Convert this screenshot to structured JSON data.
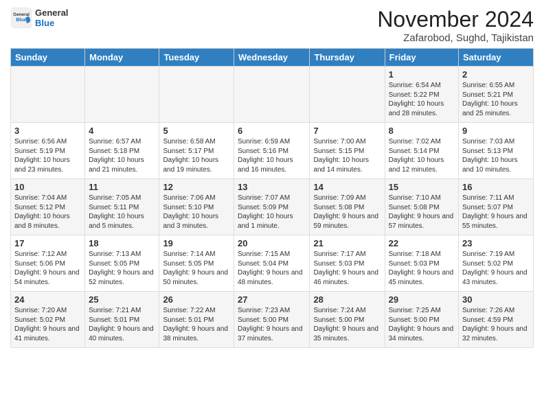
{
  "header": {
    "logo_general": "General",
    "logo_blue": "Blue",
    "month_title": "November 2024",
    "location": "Zafarobod, Sughd, Tajikistan"
  },
  "days_of_week": [
    "Sunday",
    "Monday",
    "Tuesday",
    "Wednesday",
    "Thursday",
    "Friday",
    "Saturday"
  ],
  "weeks": [
    [
      {
        "day": "",
        "info": ""
      },
      {
        "day": "",
        "info": ""
      },
      {
        "day": "",
        "info": ""
      },
      {
        "day": "",
        "info": ""
      },
      {
        "day": "",
        "info": ""
      },
      {
        "day": "1",
        "info": "Sunrise: 6:54 AM\nSunset: 5:22 PM\nDaylight: 10 hours and 28 minutes."
      },
      {
        "day": "2",
        "info": "Sunrise: 6:55 AM\nSunset: 5:21 PM\nDaylight: 10 hours and 25 minutes."
      }
    ],
    [
      {
        "day": "3",
        "info": "Sunrise: 6:56 AM\nSunset: 5:19 PM\nDaylight: 10 hours and 23 minutes."
      },
      {
        "day": "4",
        "info": "Sunrise: 6:57 AM\nSunset: 5:18 PM\nDaylight: 10 hours and 21 minutes."
      },
      {
        "day": "5",
        "info": "Sunrise: 6:58 AM\nSunset: 5:17 PM\nDaylight: 10 hours and 19 minutes."
      },
      {
        "day": "6",
        "info": "Sunrise: 6:59 AM\nSunset: 5:16 PM\nDaylight: 10 hours and 16 minutes."
      },
      {
        "day": "7",
        "info": "Sunrise: 7:00 AM\nSunset: 5:15 PM\nDaylight: 10 hours and 14 minutes."
      },
      {
        "day": "8",
        "info": "Sunrise: 7:02 AM\nSunset: 5:14 PM\nDaylight: 10 hours and 12 minutes."
      },
      {
        "day": "9",
        "info": "Sunrise: 7:03 AM\nSunset: 5:13 PM\nDaylight: 10 hours and 10 minutes."
      }
    ],
    [
      {
        "day": "10",
        "info": "Sunrise: 7:04 AM\nSunset: 5:12 PM\nDaylight: 10 hours and 8 minutes."
      },
      {
        "day": "11",
        "info": "Sunrise: 7:05 AM\nSunset: 5:11 PM\nDaylight: 10 hours and 5 minutes."
      },
      {
        "day": "12",
        "info": "Sunrise: 7:06 AM\nSunset: 5:10 PM\nDaylight: 10 hours and 3 minutes."
      },
      {
        "day": "13",
        "info": "Sunrise: 7:07 AM\nSunset: 5:09 PM\nDaylight: 10 hours and 1 minute."
      },
      {
        "day": "14",
        "info": "Sunrise: 7:09 AM\nSunset: 5:08 PM\nDaylight: 9 hours and 59 minutes."
      },
      {
        "day": "15",
        "info": "Sunrise: 7:10 AM\nSunset: 5:08 PM\nDaylight: 9 hours and 57 minutes."
      },
      {
        "day": "16",
        "info": "Sunrise: 7:11 AM\nSunset: 5:07 PM\nDaylight: 9 hours and 55 minutes."
      }
    ],
    [
      {
        "day": "17",
        "info": "Sunrise: 7:12 AM\nSunset: 5:06 PM\nDaylight: 9 hours and 54 minutes."
      },
      {
        "day": "18",
        "info": "Sunrise: 7:13 AM\nSunset: 5:05 PM\nDaylight: 9 hours and 52 minutes."
      },
      {
        "day": "19",
        "info": "Sunrise: 7:14 AM\nSunset: 5:05 PM\nDaylight: 9 hours and 50 minutes."
      },
      {
        "day": "20",
        "info": "Sunrise: 7:15 AM\nSunset: 5:04 PM\nDaylight: 9 hours and 48 minutes."
      },
      {
        "day": "21",
        "info": "Sunrise: 7:17 AM\nSunset: 5:03 PM\nDaylight: 9 hours and 46 minutes."
      },
      {
        "day": "22",
        "info": "Sunrise: 7:18 AM\nSunset: 5:03 PM\nDaylight: 9 hours and 45 minutes."
      },
      {
        "day": "23",
        "info": "Sunrise: 7:19 AM\nSunset: 5:02 PM\nDaylight: 9 hours and 43 minutes."
      }
    ],
    [
      {
        "day": "24",
        "info": "Sunrise: 7:20 AM\nSunset: 5:02 PM\nDaylight: 9 hours and 41 minutes."
      },
      {
        "day": "25",
        "info": "Sunrise: 7:21 AM\nSunset: 5:01 PM\nDaylight: 9 hours and 40 minutes."
      },
      {
        "day": "26",
        "info": "Sunrise: 7:22 AM\nSunset: 5:01 PM\nDaylight: 9 hours and 38 minutes."
      },
      {
        "day": "27",
        "info": "Sunrise: 7:23 AM\nSunset: 5:00 PM\nDaylight: 9 hours and 37 minutes."
      },
      {
        "day": "28",
        "info": "Sunrise: 7:24 AM\nSunset: 5:00 PM\nDaylight: 9 hours and 35 minutes."
      },
      {
        "day": "29",
        "info": "Sunrise: 7:25 AM\nSunset: 5:00 PM\nDaylight: 9 hours and 34 minutes."
      },
      {
        "day": "30",
        "info": "Sunrise: 7:26 AM\nSunset: 4:59 PM\nDaylight: 9 hours and 32 minutes."
      }
    ]
  ]
}
